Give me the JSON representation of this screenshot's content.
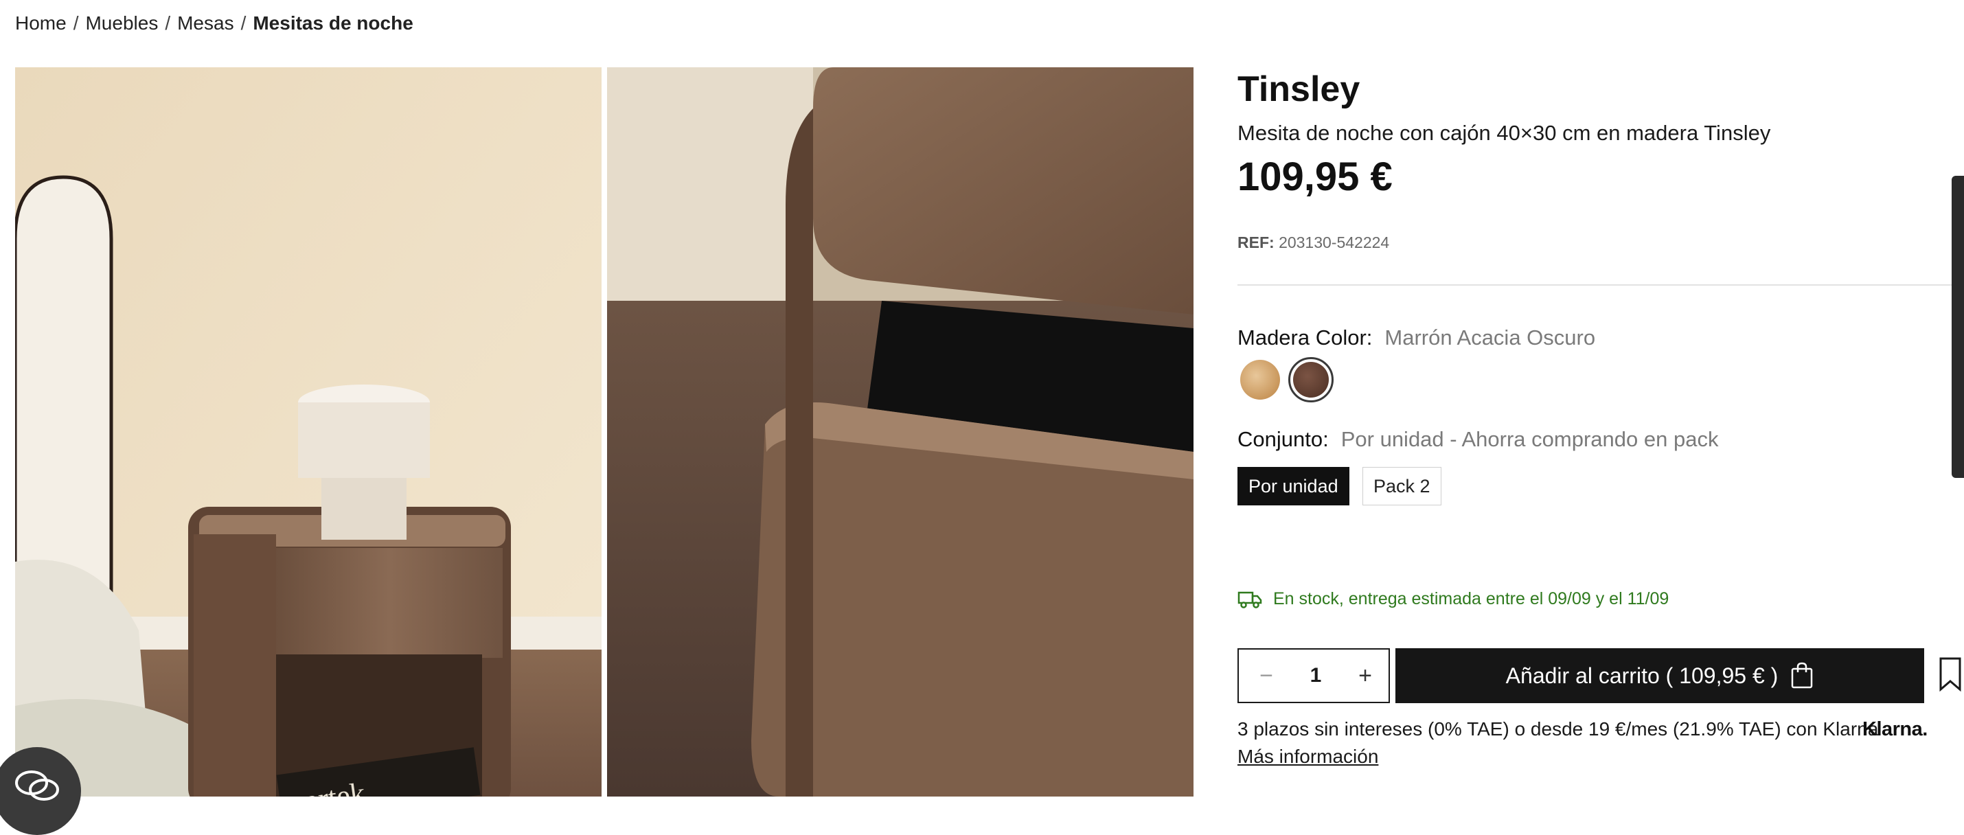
{
  "breadcrumb": {
    "items": [
      "Home",
      "Muebles",
      "Mesas"
    ],
    "separator": "/",
    "current": "Mesitas de noche"
  },
  "product": {
    "name": "Tinsley",
    "subtitle": "Mesita de noche con cajón 40×30 cm en madera Tinsley",
    "price": "109,95 €",
    "ref_label": "REF:",
    "ref_value": "203130-542224"
  },
  "options": {
    "color": {
      "label": "Madera Color:",
      "selected": "Marrón Acacia Oscuro",
      "swatches": [
        {
          "name": "light-acacia",
          "color": "#d4a66e",
          "selected": false
        },
        {
          "name": "dark-acacia",
          "color": "#5a3a2d",
          "selected": true
        }
      ]
    },
    "set": {
      "label": "Conjunto:",
      "selected": "Por unidad - Ahorra comprando en pack",
      "buttons": [
        "Por unidad",
        "Pack 2"
      ]
    }
  },
  "stock": {
    "text": "En stock, entrega estimada entre el 09/09 y el 11/09",
    "color": "#2f7a1e"
  },
  "cart": {
    "quantity": "1",
    "minus": "−",
    "plus": "+",
    "add_label": "Añadir al carrito ( 109,95 € )"
  },
  "financing": {
    "text": "3 plazos sin intereses (0% TAE) o desde 19 €/mes (21.9% TAE) con Klarna",
    "brand": "Klarna.",
    "more_info": "Más información"
  },
  "book": {
    "text": "artek"
  },
  "colors": {
    "primary_button": "#161616",
    "stock_green": "#2f7a1e",
    "muted_text": "#7a7a7a"
  },
  "icons": [
    "truck-icon",
    "shopping-bag-icon",
    "bookmark-icon",
    "chat-icon"
  ]
}
